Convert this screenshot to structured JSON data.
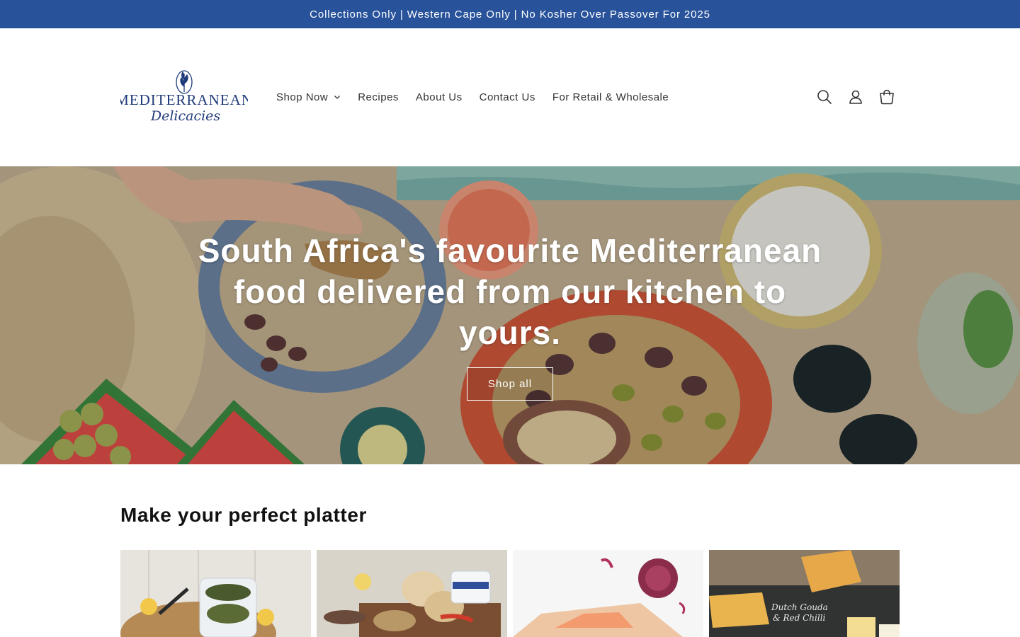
{
  "announcement": {
    "text": "Collections Only | Western Cape Only | No Kosher Over Passover For 2025"
  },
  "header": {
    "logo": {
      "line1": "MEDITERRANEAN",
      "line2": "Delicacies"
    },
    "nav": [
      {
        "label": "Shop Now",
        "has_dropdown": true
      },
      {
        "label": "Recipes"
      },
      {
        "label": "About Us"
      },
      {
        "label": "Contact Us"
      },
      {
        "label": "For Retail & Wholesale"
      }
    ],
    "icons": [
      "search-icon",
      "account-icon",
      "cart-icon"
    ]
  },
  "hero": {
    "title": "South Africa's favourite Mediterranean food delivered from our kitchen to yours.",
    "button_label": "Shop all"
  },
  "collection": {
    "title": "Make your perfect platter",
    "cards": [
      {
        "image": "vine-leaves-tub"
      },
      {
        "image": "bread-and-dips"
      },
      {
        "image": "salmon-and-onion"
      },
      {
        "image": "cheese-board",
        "chalk_text_line1": "Dutch Gouda",
        "chalk_text_line2": "& Red Chilli"
      }
    ]
  },
  "colors": {
    "brand_blue": "#28529a",
    "logo_navy": "#1f3a7a"
  }
}
